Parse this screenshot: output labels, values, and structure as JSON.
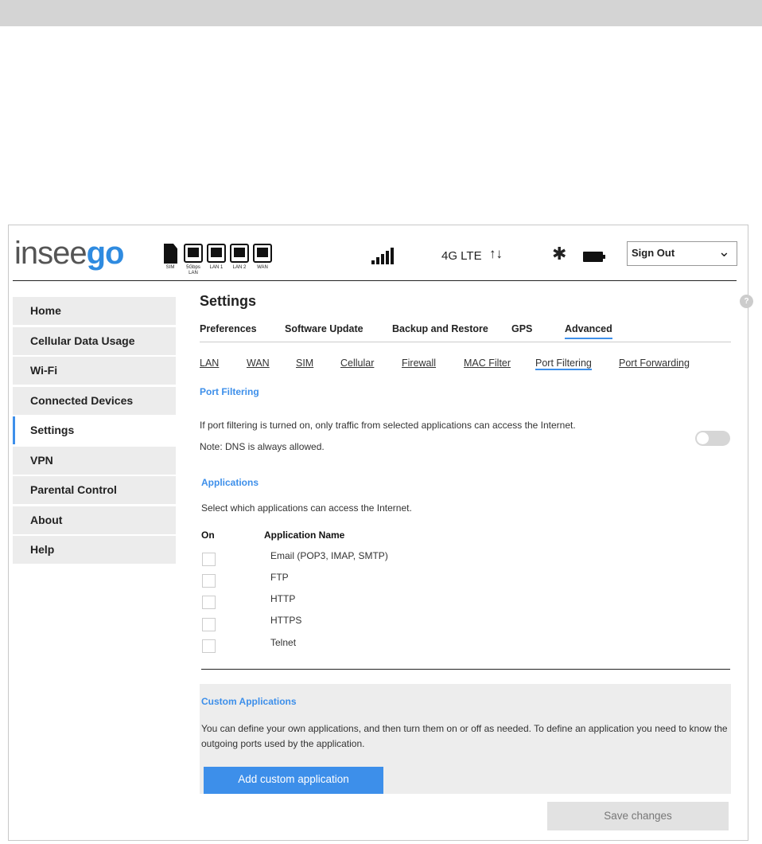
{
  "header": {
    "logo_left": "insee",
    "logo_right": "go",
    "ports": [
      "SIM",
      "5Gbps LAN",
      "LAN 1",
      "LAN 2",
      "WAN"
    ],
    "network": "4G LTE",
    "sign_out": "Sign Out"
  },
  "sidebar": {
    "items": [
      {
        "label": "Home"
      },
      {
        "label": "Cellular Data Usage"
      },
      {
        "label": "Wi-Fi"
      },
      {
        "label": "Connected Devices"
      },
      {
        "label": "Settings",
        "active": true
      },
      {
        "label": "VPN"
      },
      {
        "label": "Parental Control"
      },
      {
        "label": "About"
      },
      {
        "label": "Help"
      }
    ]
  },
  "main": {
    "title": "Settings",
    "help": "?",
    "tabs": [
      "Preferences",
      "Software Update",
      "Backup and Restore",
      "GPS",
      "Advanced"
    ],
    "subtabs": [
      "LAN",
      "WAN",
      "SIM",
      "Cellular",
      "Firewall",
      "MAC Filter",
      "Port Filtering",
      "Port Forwarding"
    ],
    "section_title": "Port Filtering",
    "description": "If port filtering is turned on, only traffic from selected applications can access the Internet.",
    "note": "Note: DNS is always allowed.",
    "port_filtering_on": false,
    "apps_title": "Applications",
    "apps_desc": "Select which applications can access the Internet.",
    "col_on": "On",
    "col_name": "Application Name",
    "apps": [
      "Email (POP3, IMAP, SMTP)",
      "FTP",
      "HTTP",
      "HTTPS",
      "Telnet"
    ],
    "custom_title": "Custom Applications",
    "custom_desc": "You can define your own applications, and then turn them on or off as needed. To define an application you need to know the outgoing ports used by the application.",
    "add_button": "Add custom application",
    "save_button": "Save changes"
  },
  "colors": {
    "accent": "#3d8fea"
  }
}
